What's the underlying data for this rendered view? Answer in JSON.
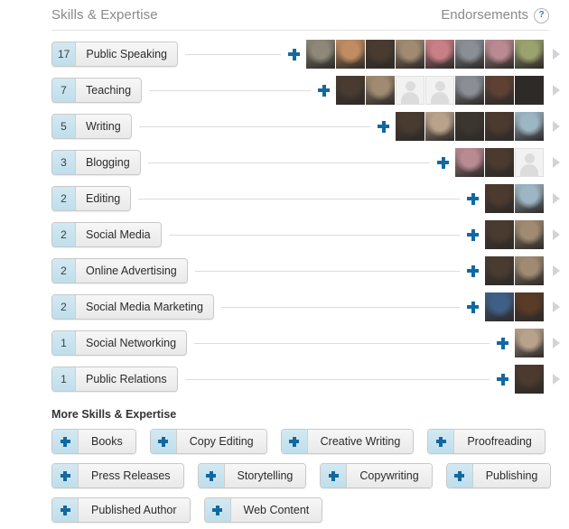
{
  "header": {
    "section_title": "Skills & Expertise",
    "endorsements_label": "Endorsements",
    "help_icon_glyph": "?",
    "help_icon_name": "question-mark-icon"
  },
  "colors": {
    "accent_blue": "#1269a0",
    "count_badge_bg": "#c5e1ec",
    "pill_bg": "#f0f0f0",
    "pill_border": "#c9c9c9",
    "divider": "#e2e2e2",
    "chevron": "#d3d3d3",
    "muted_text": "#8a8a8a"
  },
  "skills": [
    {
      "count": "17",
      "name": "Public Speaking",
      "avatars": [
        {
          "type": "photo",
          "tone": "#8d8878"
        },
        {
          "type": "photo",
          "tone": "#c08c63"
        },
        {
          "type": "photo",
          "tone": "#4a3b30"
        },
        {
          "type": "photo",
          "tone": "#a08b72"
        },
        {
          "type": "photo",
          "tone": "#c97f86"
        },
        {
          "type": "photo",
          "tone": "#8a8f96"
        },
        {
          "type": "photo",
          "tone": "#b98a92"
        },
        {
          "type": "photo",
          "tone": "#9aa36e"
        }
      ]
    },
    {
      "count": "7",
      "name": "Teaching",
      "avatars": [
        {
          "type": "photo",
          "tone": "#4a3b30"
        },
        {
          "type": "photo",
          "tone": "#a08b72"
        },
        {
          "type": "placeholder",
          "tone": "#f2f2f2"
        },
        {
          "type": "placeholder",
          "tone": "#f2f2f2"
        },
        {
          "type": "photo",
          "tone": "#8a8f96"
        },
        {
          "type": "photo",
          "tone": "#5e4034"
        },
        {
          "type": "photo",
          "tone": "#2d2a28"
        }
      ]
    },
    {
      "count": "5",
      "name": "Writing",
      "avatars": [
        {
          "type": "photo",
          "tone": "#4a3b30"
        },
        {
          "type": "photo",
          "tone": "#b9a28c"
        },
        {
          "type": "photo",
          "tone": "#3c3630"
        },
        {
          "type": "photo",
          "tone": "#4c3a2e"
        },
        {
          "type": "photo",
          "tone": "#9db6c4"
        }
      ]
    },
    {
      "count": "3",
      "name": "Blogging",
      "avatars": [
        {
          "type": "photo",
          "tone": "#b98a92"
        },
        {
          "type": "photo",
          "tone": "#4c3a2e"
        },
        {
          "type": "placeholder",
          "tone": "#f2f2f2"
        }
      ]
    },
    {
      "count": "2",
      "name": "Editing",
      "avatars": [
        {
          "type": "photo",
          "tone": "#4c3a2e"
        },
        {
          "type": "photo",
          "tone": "#9db6c4"
        }
      ]
    },
    {
      "count": "2",
      "name": "Social Media",
      "avatars": [
        {
          "type": "photo",
          "tone": "#4a3b30"
        },
        {
          "type": "photo",
          "tone": "#a08b72"
        }
      ]
    },
    {
      "count": "2",
      "name": "Online Advertising",
      "avatars": [
        {
          "type": "photo",
          "tone": "#4a3b30"
        },
        {
          "type": "photo",
          "tone": "#a08b72"
        }
      ]
    },
    {
      "count": "2",
      "name": "Social Media Marketing",
      "avatars": [
        {
          "type": "photo",
          "tone": "#3f5f86"
        },
        {
          "type": "photo",
          "tone": "#5a3b28"
        }
      ]
    },
    {
      "count": "1",
      "name": "Social Networking",
      "avatars": [
        {
          "type": "photo",
          "tone": "#b9a28c"
        }
      ]
    },
    {
      "count": "1",
      "name": "Public Relations",
      "avatars": [
        {
          "type": "photo",
          "tone": "#4c3a2e"
        }
      ]
    }
  ],
  "more_skills": {
    "title": "More Skills & Expertise",
    "rows": [
      [
        "Books",
        "Copy Editing",
        "Creative Writing",
        "Proofreading"
      ],
      [
        "Press Releases",
        "Storytelling",
        "Copywriting",
        "Publishing"
      ],
      [
        "Published Author",
        "Web Content"
      ]
    ]
  }
}
